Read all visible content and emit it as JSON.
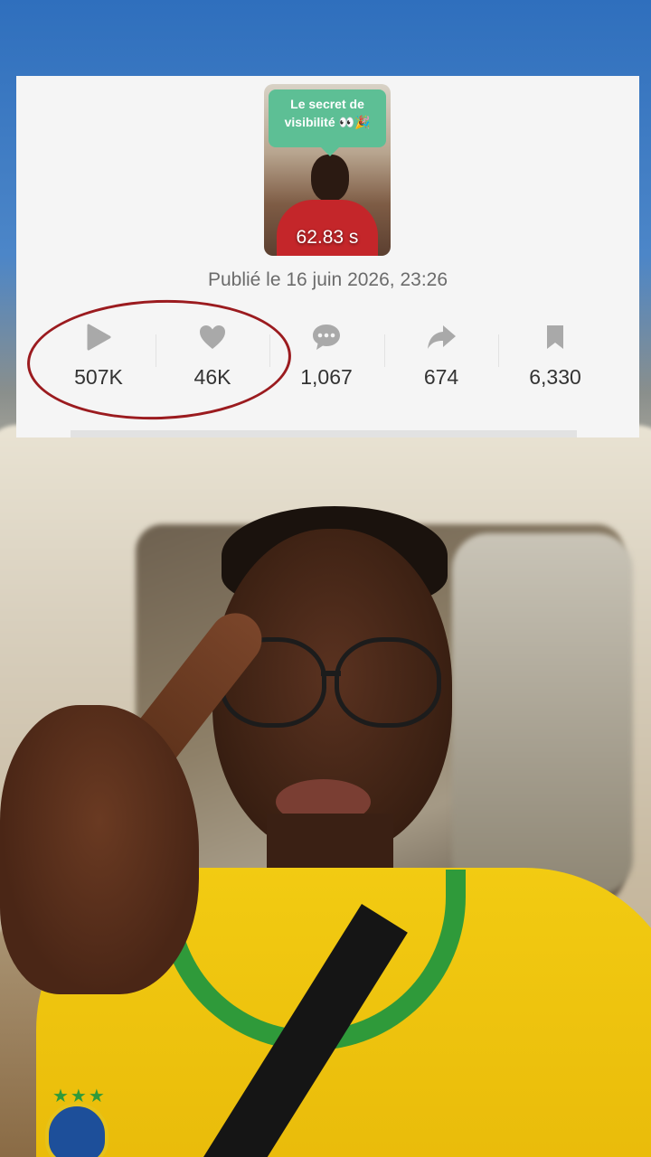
{
  "video": {
    "thumbnail_caption_line1": "Le secret de",
    "thumbnail_caption_line2": "visibilité 👀🎉",
    "duration": "62.83 s"
  },
  "published": "Publié le 16 juin 2026, 23:26",
  "stats": {
    "views": {
      "icon": "play-icon",
      "value": "507K"
    },
    "likes": {
      "icon": "heart-icon",
      "value": "46K"
    },
    "comments": {
      "icon": "comment-icon",
      "value": "1,067"
    },
    "shares": {
      "icon": "share-icon",
      "value": "674"
    },
    "saves": {
      "icon": "bookmark-icon",
      "value": "6,330"
    }
  },
  "colors": {
    "card_bg": "#f5f5f5",
    "icon_gray": "#a9a9a9",
    "annotation_red": "#9b1b1f",
    "bubble_green": "#5dbf95"
  }
}
